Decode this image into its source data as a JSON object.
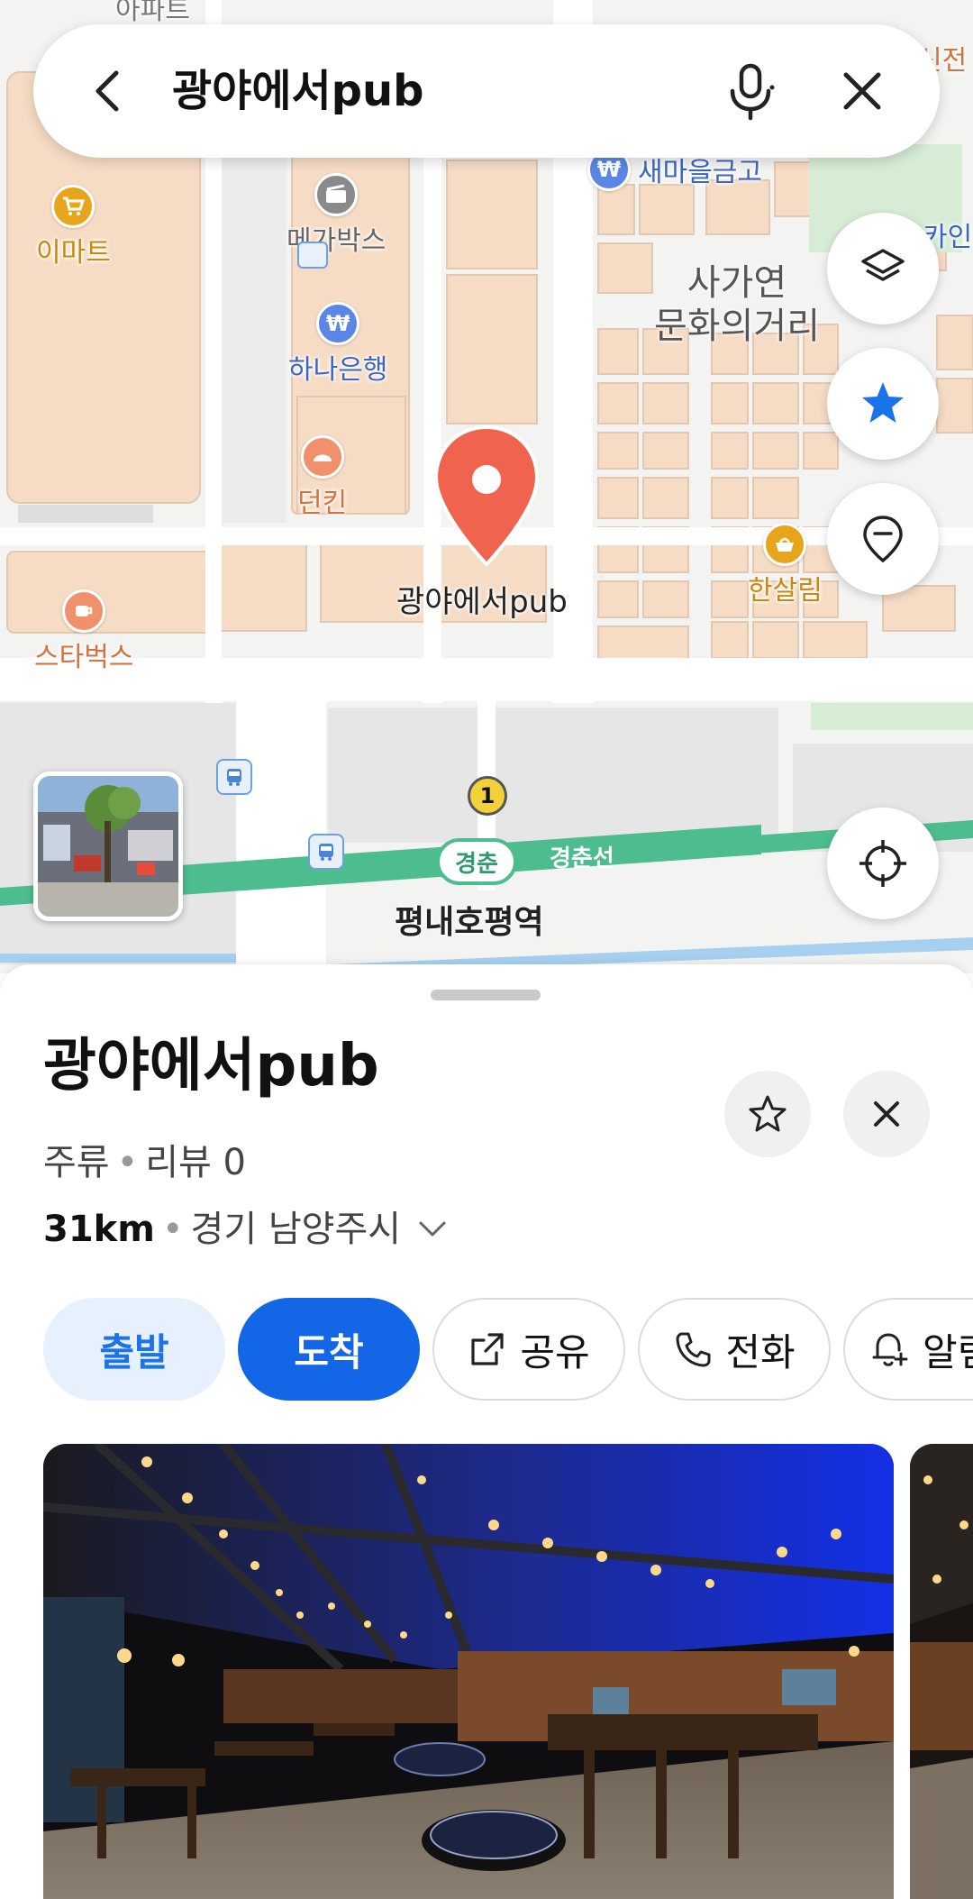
{
  "search": {
    "query": "광야에서pub"
  },
  "map": {
    "pois": {
      "emart": "이마트",
      "megabox": "메가박스",
      "hana": "하나은행",
      "dunkin": "던킨",
      "starbucks": "스타벅스",
      "hansalim": "한살림",
      "saemaeul": "새마을금고",
      "apartment_partial": "아파트",
      "sinjeon_partial": "신전",
      "kain_partial": "카인"
    },
    "area_label": "사가연\n문화의거리",
    "pin_label": "광야에서pub",
    "station": {
      "line_badge": "경춘",
      "line_label": "경춘선",
      "exit_number": "1",
      "name": "평내호평역"
    }
  },
  "place": {
    "title": "광야에서pub",
    "category": "주류",
    "reviews": "리뷰 0",
    "distance": "31km",
    "address": "경기 남양주시"
  },
  "actions": {
    "start": "출발",
    "arrive": "도착",
    "share": "공유",
    "call": "전화",
    "alert_partial": "알림"
  },
  "colors": {
    "accent": "#1366e6",
    "pin": "#f0634f",
    "rail": "#4dbd8f",
    "favorite": "#1a73e8"
  }
}
